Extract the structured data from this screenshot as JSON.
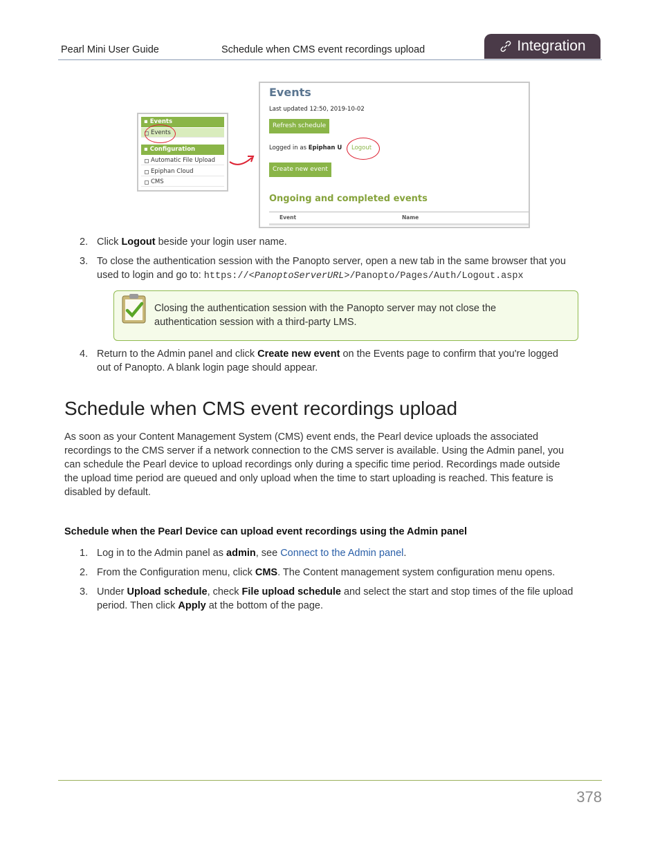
{
  "header": {
    "guide_title": "Pearl Mini User Guide",
    "section_title": "Schedule when CMS event recordings upload",
    "tab_label": "Integration",
    "tab_icon": "link-icon"
  },
  "figure": {
    "nav": {
      "events_header": "Events",
      "events_item": "Events",
      "config_header": "Configuration",
      "config_items": [
        "Automatic File Upload",
        "Epiphan Cloud",
        "CMS"
      ]
    },
    "events_panel": {
      "title": "Events",
      "last_updated": "Last updated 12:50, 2019-10-02",
      "refresh_button": "Refresh schedule",
      "logged_in_prefix": "Logged in as ",
      "logged_in_user": "Epiphan U",
      "logout_link": "Logout",
      "create_button": "Create new event",
      "ongoing_title": "Ongoing and completed events",
      "col_event": "Event",
      "col_name": "Name"
    }
  },
  "steps_a": [
    {
      "num": "2.",
      "pre": "Click ",
      "bold": "Logout",
      "post": " beside your login user name."
    },
    {
      "num": "3.",
      "line1": "To close the authentication session with the Panopto server, open a new tab in the same browser that you",
      "line2_pre": "used to login and go to: ",
      "url_a": "https://<",
      "url_b": "PanoptoServerURL",
      "url_c": ">/Panopto/Pages/Auth/Logout.aspx"
    }
  ],
  "note": {
    "line1": "Closing the authentication session with the Panopto server may not close the",
    "line2": "authentication session with a third-party LMS."
  },
  "step4": {
    "num": "4.",
    "pre": "Return to the Admin panel and click ",
    "bold": "Create new event",
    "post": " on the Events page to confirm that you're logged",
    "line2": "out of Panopto. A blank login page should appear."
  },
  "section": {
    "heading": "Schedule when CMS event recordings upload",
    "para": [
      "As soon as your Content Management System (CMS) event ends, the Pearl device uploads the associated",
      "recordings to the CMS server if a network connection to the CMS server is available. Using the Admin panel, you",
      "can schedule the Pearl device to upload recordings only during a specific time period. Recordings made outside",
      "the upload time period are queued and only upload when the time to start uploading is reached. This feature is",
      "disabled by default."
    ],
    "subheading": "Schedule when the Pearl Device can upload event recordings using the Admin panel"
  },
  "steps_b": {
    "s1": {
      "num": "1.",
      "pre": "Log in to the Admin panel as ",
      "bold": "admin",
      "mid": ", see ",
      "link": "Connect to the Admin panel",
      "post": "."
    },
    "s2": {
      "num": "2.",
      "pre": "From the Configuration menu, click ",
      "bold": "CMS",
      "post": ". The Content management system configuration menu opens."
    },
    "s3": {
      "num": "3.",
      "pre": "Under ",
      "bold1": "Upload schedule",
      "mid": ", check ",
      "bold2": "File upload schedule",
      "post": " and select the start and stop times of the file upload",
      "line2_pre": "period. Then click ",
      "bold3": "Apply",
      "line2_post": " at the bottom of the page."
    }
  },
  "footer": {
    "page_number": "378"
  }
}
